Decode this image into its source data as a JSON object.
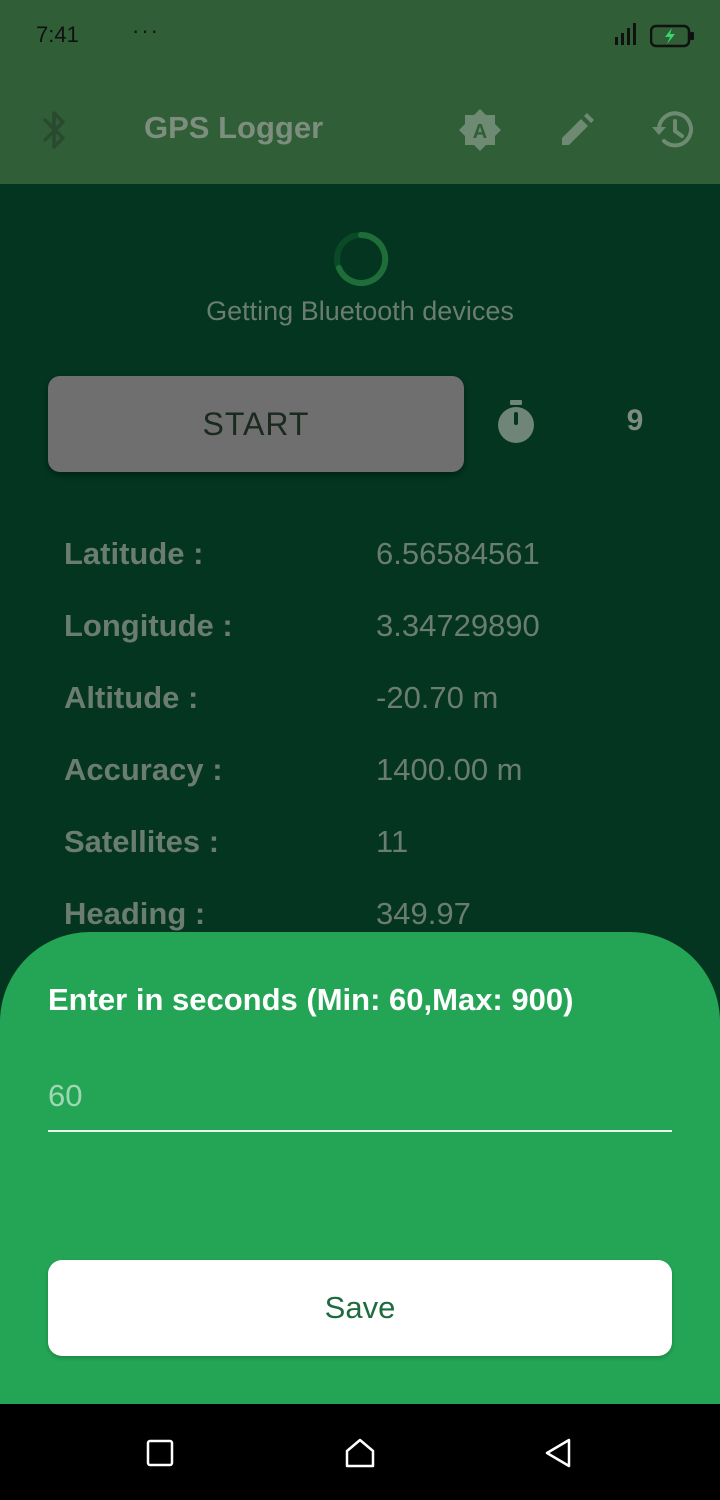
{
  "status_bar": {
    "time": "7:41",
    "more": "···"
  },
  "app_bar": {
    "title": "GPS Logger",
    "icons": [
      "bluetooth-icon",
      "brightness-auto-icon",
      "edit-icon",
      "history-icon"
    ]
  },
  "main": {
    "loading_text": "Getting Bluetooth devices",
    "start_label": "START",
    "timer_value": "9",
    "rows": [
      {
        "label": "Latitude :",
        "value": "6.56584561"
      },
      {
        "label": "Longitude :",
        "value": "3.34729890"
      },
      {
        "label": "Altitude :",
        "value": "-20.70 m"
      },
      {
        "label": "Accuracy :",
        "value": "1400.00 m"
      },
      {
        "label": "Satellites :",
        "value": "11"
      },
      {
        "label": "Heading :",
        "value": "349.97"
      }
    ]
  },
  "sheet": {
    "title": "Enter in seconds (Min: 60,Max: 900)",
    "input_placeholder": "60",
    "save_label": "Save"
  },
  "nav_bar": {
    "icons": [
      "recents-icon",
      "home-icon",
      "back-icon"
    ]
  },
  "colors": {
    "sheet": "#24a555",
    "app_bar": "#2f5e37",
    "background": "#033520"
  }
}
